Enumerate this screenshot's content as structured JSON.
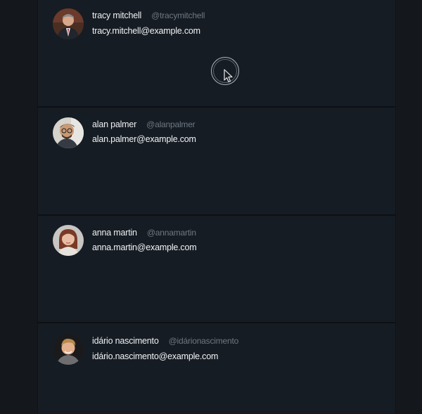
{
  "users": [
    {
      "name": "tracy mitchell",
      "handle": "@tracymitchell",
      "email": "tracy.mitchell@example.com",
      "avatar_icon": "person-avatar-suit"
    },
    {
      "name": "alan palmer",
      "handle": "@alanpalmer",
      "email": "alan.palmer@example.com",
      "avatar_icon": "person-avatar-glasses"
    },
    {
      "name": "anna martin",
      "handle": "@annamartin",
      "email": "anna.martin@example.com",
      "avatar_icon": "person-avatar-woman"
    },
    {
      "name": "idário nascimento",
      "handle": "@idárionascimento",
      "email": "idário.nascimento@example.com",
      "avatar_icon": "person-avatar-man"
    }
  ],
  "colors": {
    "background": "#14181d",
    "card": "#161c23",
    "name_text": "#eef1f5",
    "handle_text": "#6e7782",
    "divider": "#0d1014"
  },
  "cursor_icon": "mouse-pointer-icon"
}
